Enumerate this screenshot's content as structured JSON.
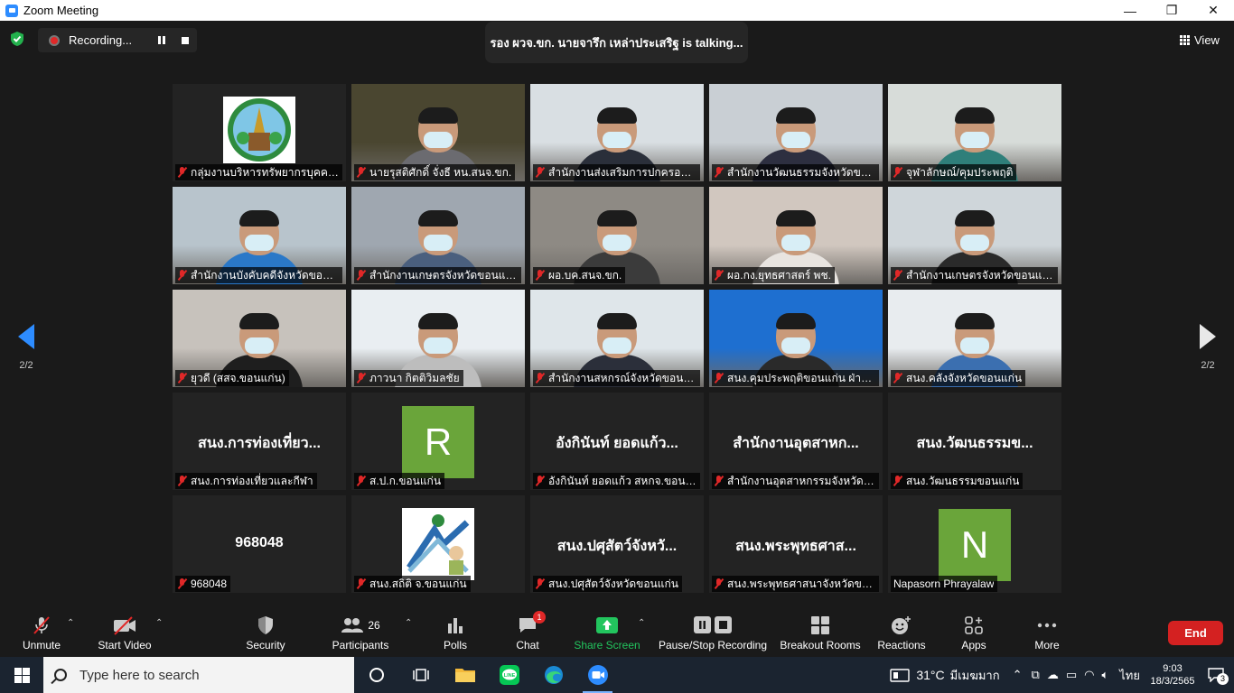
{
  "window": {
    "title": "Zoom Meeting",
    "minimize": "—",
    "restore": "❐",
    "close": "✕"
  },
  "recording": {
    "label": "Recording..."
  },
  "talking": {
    "text": "รอง ผวจ.ขก. นายจารึก เหล่าประเสริฐ is talking..."
  },
  "view": {
    "label": "View"
  },
  "pager": {
    "left": "2/2",
    "right": "2/2"
  },
  "tiles": [
    {
      "type": "logo",
      "name": "กลุ่มงานบริหารทรัพยากรบุคคล ...",
      "muted": true
    },
    {
      "type": "video",
      "name": "นายรุสติศักดิ์ จั่งธี หน.สนจ.ขก.",
      "muted": true
    },
    {
      "type": "video",
      "name": "สำนักงานส่งเสริมการปกครองท้อ...",
      "muted": true
    },
    {
      "type": "video",
      "name": "สำนักงานวัฒนธรรมจังหวัดขอน...",
      "muted": true
    },
    {
      "type": "video",
      "name": "จุฬาลักษณ์/คุมประพฤติ",
      "muted": true
    },
    {
      "type": "video",
      "name": "สำนักงานบังคับคดีจังหวัดขอนแก่...",
      "muted": true
    },
    {
      "type": "video",
      "name": "สำนักงานเกษตรจังหวัดขอนแก่น",
      "muted": true
    },
    {
      "type": "video",
      "name": "ผอ.บค.สนจ.ขก.",
      "muted": true
    },
    {
      "type": "video",
      "name": "ผอ.กง.ยุทธศาสตร์ พช.",
      "muted": true
    },
    {
      "type": "video",
      "name": "สำนักงานเกษตรจังหวัดขอนแก่น",
      "muted": true
    },
    {
      "type": "video",
      "name": "ยุวดี (สสจ.ขอนแก่น)",
      "muted": true
    },
    {
      "type": "video",
      "name": "ภาวนา กิตติวิมลชัย",
      "muted": true
    },
    {
      "type": "video",
      "name": "สำนักงานสหกรณ์จังหวัดขอนแก่น",
      "muted": true
    },
    {
      "type": "video",
      "name": "สนง.คุมประพฤติขอนแก่น ฝ่ายยุ...",
      "muted": true
    },
    {
      "type": "video",
      "name": "สนง.คลังจังหวัดขอนแก่น",
      "muted": true
    },
    {
      "type": "text",
      "big": "สนง.การท่องเที่ยว...",
      "name": "สนง.การท่องเที่ยวและกีฬา",
      "muted": true
    },
    {
      "type": "avatar",
      "letter": "R",
      "name": "ส.ป.ก.ขอนแก่น",
      "muted": true
    },
    {
      "type": "text",
      "big": "อังกินันท์ ยอดแก้ว...",
      "name": "อังกินันท์ ยอดแก้ว สหกจ.ขอนแก่น",
      "muted": true
    },
    {
      "type": "text",
      "big": "สำนักงานอุตสาหก...",
      "name": "สำนักงานอุตสาหกรรมจังหวัดขอ...",
      "muted": true
    },
    {
      "type": "text",
      "big": "สนง.วัฒนธรรมข...",
      "name": "สนง.วัฒนธรรมขอนแก่น",
      "muted": true
    },
    {
      "type": "text",
      "big": "968048",
      "name": "968048",
      "muted": true
    },
    {
      "type": "logo2",
      "name": "สนง.สถิติ จ.ขอนแก่น",
      "muted": true
    },
    {
      "type": "text",
      "big": "สนง.ปศุสัตว์จังหวั...",
      "name": "สนง.ปศุสัตว์จังหวัดขอนแก่น",
      "muted": true
    },
    {
      "type": "text",
      "big": "สนง.พระพุทธศาส...",
      "name": "สนง.พระพุทธศาสนาจังหวัดขอน...",
      "muted": true
    },
    {
      "type": "avatar",
      "letter": "N",
      "name": "Napasorn Phrayalaw",
      "muted": false
    }
  ],
  "toolbar": {
    "unmute": "Unmute",
    "start_video": "Start Video",
    "security": "Security",
    "participants": "Participants",
    "participants_count": "26",
    "polls": "Polls",
    "chat": "Chat",
    "chat_badge": "1",
    "share_screen": "Share Screen",
    "pause_recording": "Pause/Stop Recording",
    "breakout": "Breakout Rooms",
    "reactions": "Reactions",
    "apps": "Apps",
    "more": "More",
    "end": "End",
    "share_color": "#22c55e"
  },
  "taskbar": {
    "search_placeholder": "Type here to search",
    "weather": "31°C",
    "weather_text": "มีเมฆมาก",
    "lang": "ไทย",
    "time": "9:03",
    "date": "18/3/2565",
    "notif_count": "3"
  }
}
